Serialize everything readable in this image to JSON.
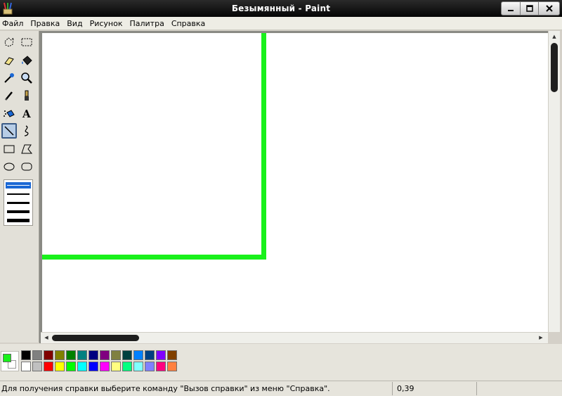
{
  "window": {
    "title": "Безымянный - Paint"
  },
  "menu": [
    "Файл",
    "Правка",
    "Вид",
    "Рисунок",
    "Палитра",
    "Справка"
  ],
  "tools": [
    "free-form-select-icon",
    "rect-select-icon",
    "eraser-icon",
    "fill-bucket-icon",
    "color-picker-icon",
    "magnifier-icon",
    "pencil-icon",
    "brush-icon",
    "airbrush-icon",
    "text-icon",
    "line-icon",
    "curve-icon",
    "rectangle-icon",
    "polygon-icon",
    "ellipse-icon",
    "rounded-rectangle-icon"
  ],
  "active_tool": "line-icon",
  "line_widths": [
    1,
    2,
    3,
    4,
    5
  ],
  "selected_line_width": 1,
  "colors": {
    "foreground": "#19f11b",
    "background": "#ffffff",
    "drawn_line": "#19f11b"
  },
  "palette": {
    "row1": [
      "#000000",
      "#808080",
      "#800000",
      "#808000",
      "#008000",
      "#008080",
      "#000080",
      "#800080",
      "#808040",
      "#004040",
      "#0080ff",
      "#004080",
      "#8000ff",
      "#804000"
    ],
    "row2": [
      "#ffffff",
      "#c0c0c0",
      "#ff0000",
      "#ffff00",
      "#00ff00",
      "#00ffff",
      "#0000ff",
      "#ff00ff",
      "#ffff80",
      "#00ff80",
      "#80ffff",
      "#8080ff",
      "#ff0080",
      "#ff8040"
    ]
  },
  "status": {
    "help_text": "Для получения справки выберите команду \"Вызов справки\" из меню \"Справка\".",
    "coords": "0,39"
  }
}
